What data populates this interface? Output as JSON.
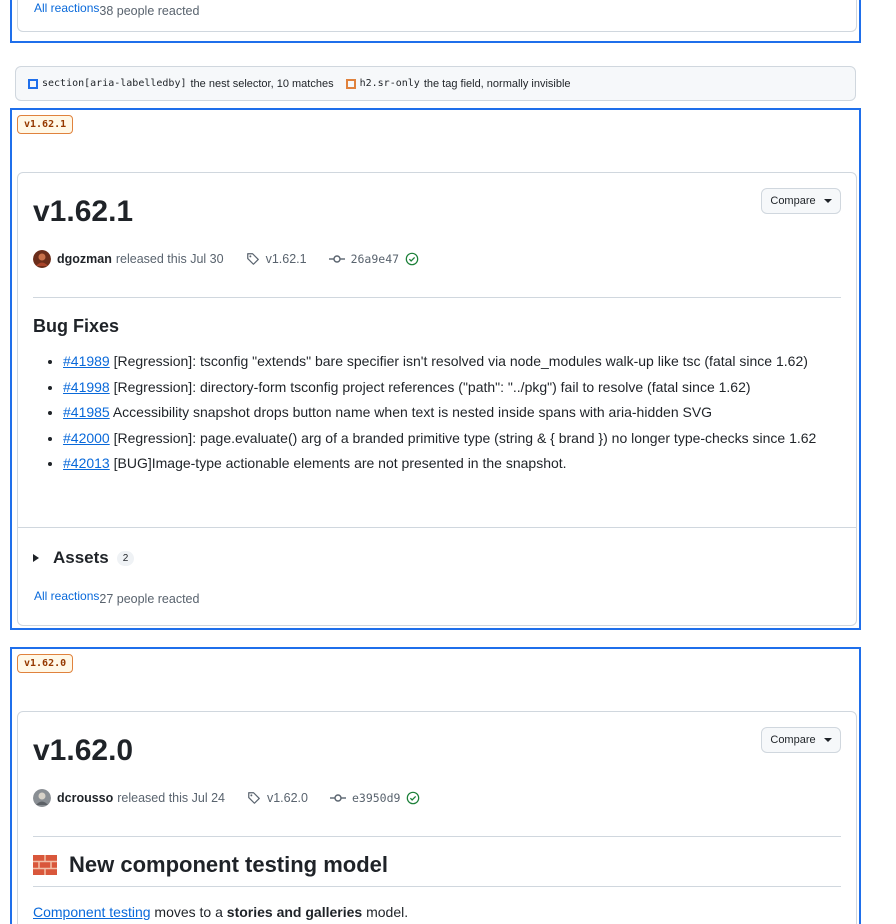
{
  "top_block": {
    "reactions_link": "All reactions",
    "reactions_count": "38 people reacted"
  },
  "legend": {
    "item1_selector": "section[aria-labelledby]",
    "item1_desc": "the nest selector, 10 matches",
    "item1_color": "#1f6feb",
    "item2_selector": "h2.sr-only",
    "item2_desc": "the tag field, normally invisible",
    "item2_color": "#e0823d"
  },
  "release1": {
    "tag_badge": "v1.62.1",
    "title": "v1.62.1",
    "compare_label": "Compare",
    "author": "dgozman",
    "released_text": "released this Jul 30",
    "tag": "v1.62.1",
    "commit": "26a9e47",
    "section_heading": "Bug Fixes",
    "items": [
      {
        "link": "#41989",
        "text": " [Regression]: tsconfig \"extends\" bare specifier isn't resolved via node_modules walk-up like tsc (fatal since 1.62)"
      },
      {
        "link": "#41998",
        "text": " [Regression]: directory-form tsconfig project references (\"path\": \"../pkg\") fail to resolve (fatal since 1.62)"
      },
      {
        "link": "#41985",
        "text": " Accessibility snapshot drops button name when text is nested inside spans with aria-hidden SVG"
      },
      {
        "link": "#42000",
        "text": " [Regression]: page.evaluate() arg of a branded primitive type (string & { brand }) no longer type-checks since 1.62"
      },
      {
        "link": "#42013",
        "text": " [BUG]Image-type actionable elements are not presented in the snapshot."
      }
    ],
    "assets_label": "Assets",
    "assets_count": "2",
    "reactions_link": "All reactions",
    "reactions_count": "27 people reacted"
  },
  "release2": {
    "tag_badge": "v1.62.0",
    "title": "v1.62.0",
    "compare_label": "Compare",
    "author": "dcrousso",
    "released_text": "released this Jul 24",
    "tag": "v1.62.0",
    "commit": "e3950d9",
    "section_heading": "New component testing model",
    "section_icon": "bricks-icon",
    "para_link": "Component testing",
    "para_mid": " moves to a ",
    "para_bold": "stories and galleries",
    "para_end": " model."
  },
  "colors": {
    "nest_border": "#1f6feb",
    "tag_badge_border": "#e0823d",
    "link": "#0969da",
    "verified_green": "#1a7f37"
  }
}
